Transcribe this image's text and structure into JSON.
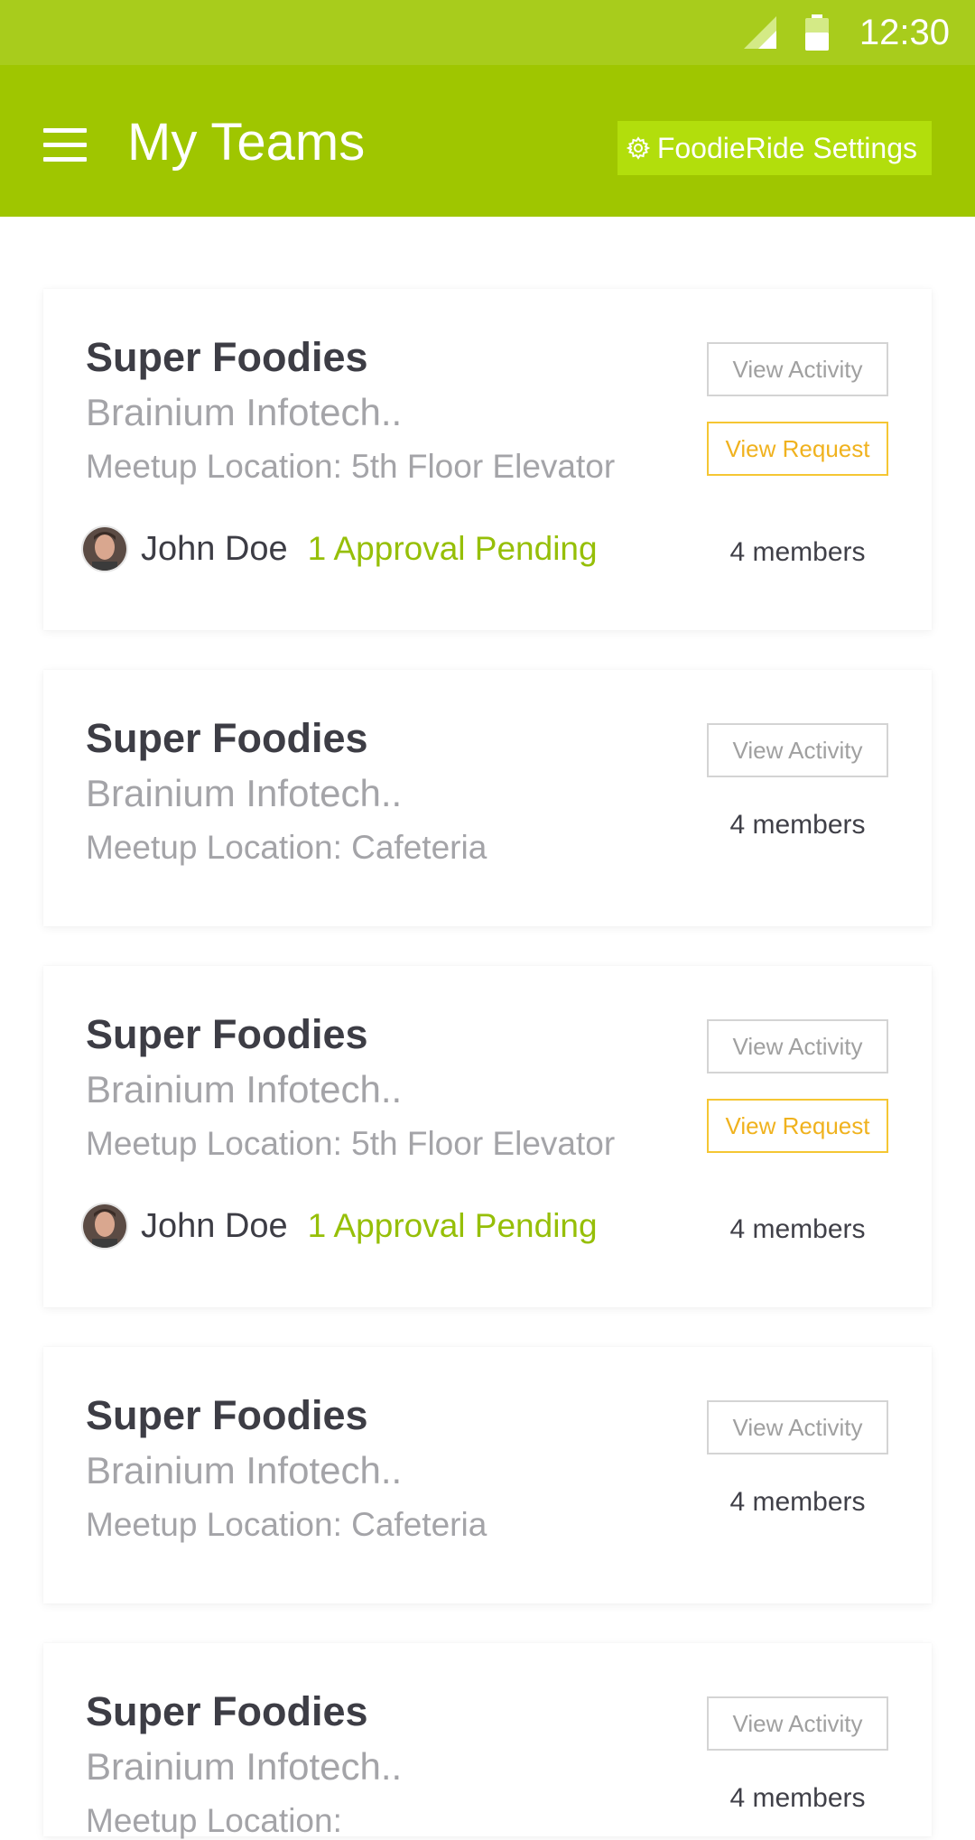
{
  "status_bar": {
    "time": "12:30"
  },
  "app_bar": {
    "title": "My Teams",
    "settings_label": "FoodieRide Settings"
  },
  "teams": [
    {
      "name": "Super Foodies",
      "company": "Brainium Infotech..",
      "location": "Meetup Location: 5th Floor Elevator",
      "view_activity": "View Activity",
      "view_request": "View Request",
      "owner": "John Doe",
      "pending": "1 Approval Pending",
      "members": "4 members"
    },
    {
      "name": "Super Foodies",
      "company": "Brainium Infotech..",
      "location": "Meetup Location: Cafeteria",
      "view_activity": "View Activity",
      "members": "4 members"
    },
    {
      "name": "Super Foodies",
      "company": "Brainium Infotech..",
      "location": "Meetup Location: 5th Floor Elevator",
      "view_activity": "View Activity",
      "view_request": "View Request",
      "owner": "John Doe",
      "pending": "1 Approval Pending",
      "members": "4 members"
    },
    {
      "name": "Super Foodies",
      "company": "Brainium Infotech..",
      "location": "Meetup Location: Cafeteria",
      "view_activity": "View Activity",
      "members": "4 members"
    },
    {
      "name": "Super Foodies",
      "company": "Brainium Infotech..",
      "location": "Meetup Location:",
      "view_activity": "View Activity",
      "members": "4 members"
    }
  ],
  "colors": {
    "status_bar": "#a8cc1c",
    "app_bar": "#9fc600",
    "settings_button": "#b2de0c",
    "pending_text": "#96bf08",
    "request_accent": "#f0b21e"
  }
}
